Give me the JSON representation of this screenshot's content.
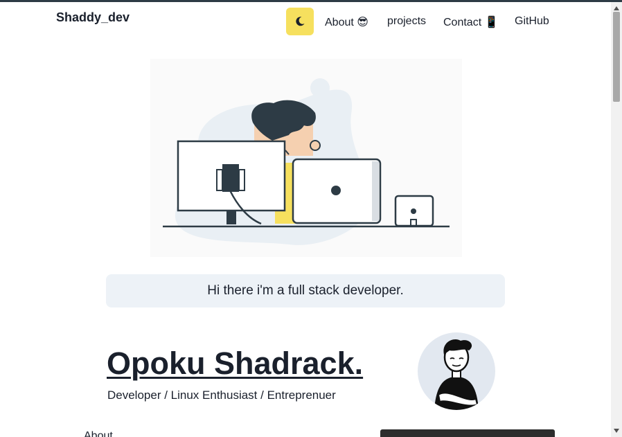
{
  "header": {
    "brand": "Shaddy_dev",
    "theme_icon": "moon-icon",
    "nav": [
      {
        "label": "About 😎"
      },
      {
        "label": "projects"
      },
      {
        "label": "Contact 📱"
      },
      {
        "label": "GitHub"
      }
    ]
  },
  "hero": {
    "illustration": "developer-at-desk-illustration",
    "greeting": "Hi there i'm a full stack developer."
  },
  "profile": {
    "name": "Opoku Shadrack.",
    "tagline": "Developer / Linux Enthusiast / Entreprenuer",
    "avatar": "avatar-illustration"
  },
  "sections": {
    "about_title": "About"
  },
  "colors": {
    "accent": "#f6e05e",
    "greeting_bg": "#edf2f7",
    "text": "#1a202c",
    "avatar_bg": "#e2e8f0"
  }
}
